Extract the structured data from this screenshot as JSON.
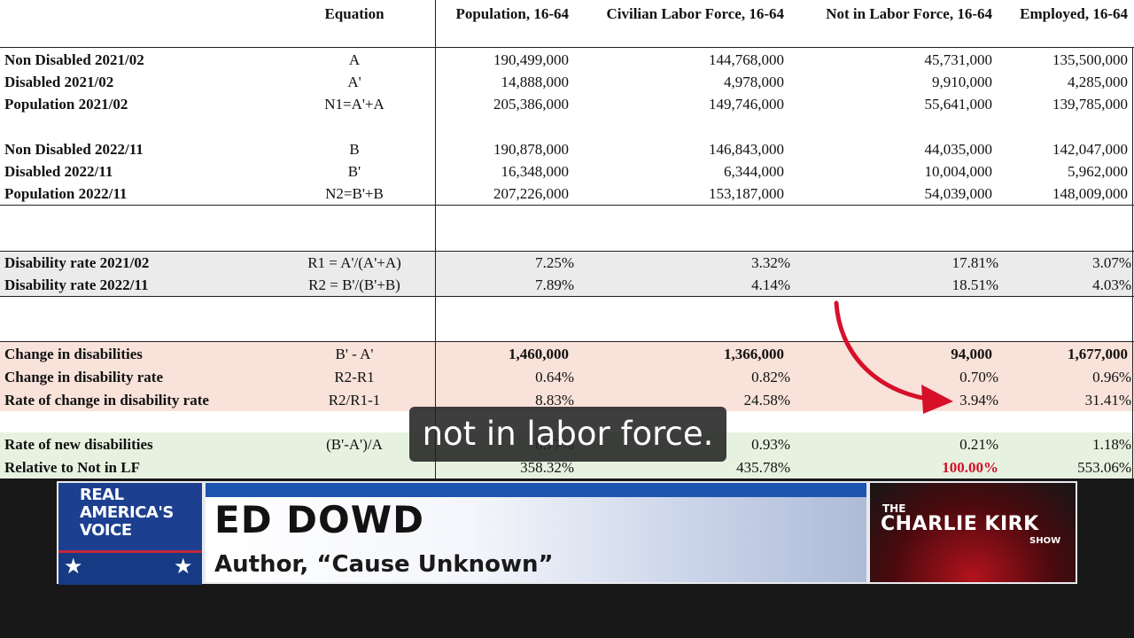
{
  "table": {
    "headers": {
      "equation": "Equation",
      "columns": [
        "Population, 16-64",
        "Civilian Labor Force, 16-64",
        "Not in Labor Force, 16-64",
        "Employed, 16-64"
      ]
    },
    "rows": [
      {
        "label": "Non Disabled 2021/02",
        "eq": "A",
        "v": [
          "190,499,000",
          "144,768,000",
          "45,731,000",
          "135,500,000"
        ]
      },
      {
        "label": "Disabled 2021/02",
        "eq": "A'",
        "v": [
          "14,888,000",
          "4,978,000",
          "9,910,000",
          "4,285,000"
        ]
      },
      {
        "label": "Population 2021/02",
        "eq": "N1=A'+A",
        "v": [
          "205,386,000",
          "149,746,000",
          "55,641,000",
          "139,785,000"
        ]
      },
      {
        "label": "Non Disabled 2022/11",
        "eq": "B",
        "v": [
          "190,878,000",
          "146,843,000",
          "44,035,000",
          "142,047,000"
        ]
      },
      {
        "label": "Disabled 2022/11",
        "eq": "B'",
        "v": [
          "16,348,000",
          "6,344,000",
          "10,004,000",
          "5,962,000"
        ]
      },
      {
        "label": "Population 2022/11",
        "eq": "N2=B'+B",
        "v": [
          "207,226,000",
          "153,187,000",
          "54,039,000",
          "148,009,000"
        ]
      },
      {
        "label": "Disability rate 2021/02",
        "eq": "R1 = A'/(A'+A)",
        "v": [
          "7.25%",
          "3.32%",
          "17.81%",
          "3.07%"
        ]
      },
      {
        "label": "Disability rate 2022/11",
        "eq": "R2 = B'/(B'+B)",
        "v": [
          "7.89%",
          "4.14%",
          "18.51%",
          "4.03%"
        ]
      },
      {
        "label": "Change in disabilities",
        "eq": "B' - A'",
        "v": [
          "1,460,000",
          "1,366,000",
          "94,000",
          "1,677,000"
        ]
      },
      {
        "label": "Change in disability rate",
        "eq": "R2-R1",
        "v": [
          "0.64%",
          "0.82%",
          "0.70%",
          "0.96%"
        ]
      },
      {
        "label": "Rate of change in disability rate",
        "eq": "R2/R1-1",
        "v": [
          "8.83%",
          "24.58%",
          "3.94%",
          "31.41%"
        ]
      },
      {
        "label": "Rate of new disabilities",
        "eq": "(B'-A')/A",
        "v": [
          "0.77%",
          "0.93%",
          "0.21%",
          "1.18%"
        ]
      },
      {
        "label": "Relative to Not in LF",
        "eq": "",
        "v": [
          "358.32%",
          "435.78%",
          "100.00%",
          "553.06%"
        ]
      }
    ]
  },
  "colors": {
    "gray_band": "#ebebeb",
    "pink_band": "#f8e2da",
    "green_band": "#e6f2df",
    "arrow": "#d7102a",
    "highlight_text": "#d0102a"
  },
  "caption": "not in labor force.",
  "lower_third": {
    "network_logo": "REAL AMERICA'S VOICE",
    "guest_name": "ED DOWD",
    "guest_title": "Author, “Cause Unknown”",
    "show_the": "THE",
    "show_name": "CHARLIE KIRK",
    "show_suffix": "SHOW"
  }
}
